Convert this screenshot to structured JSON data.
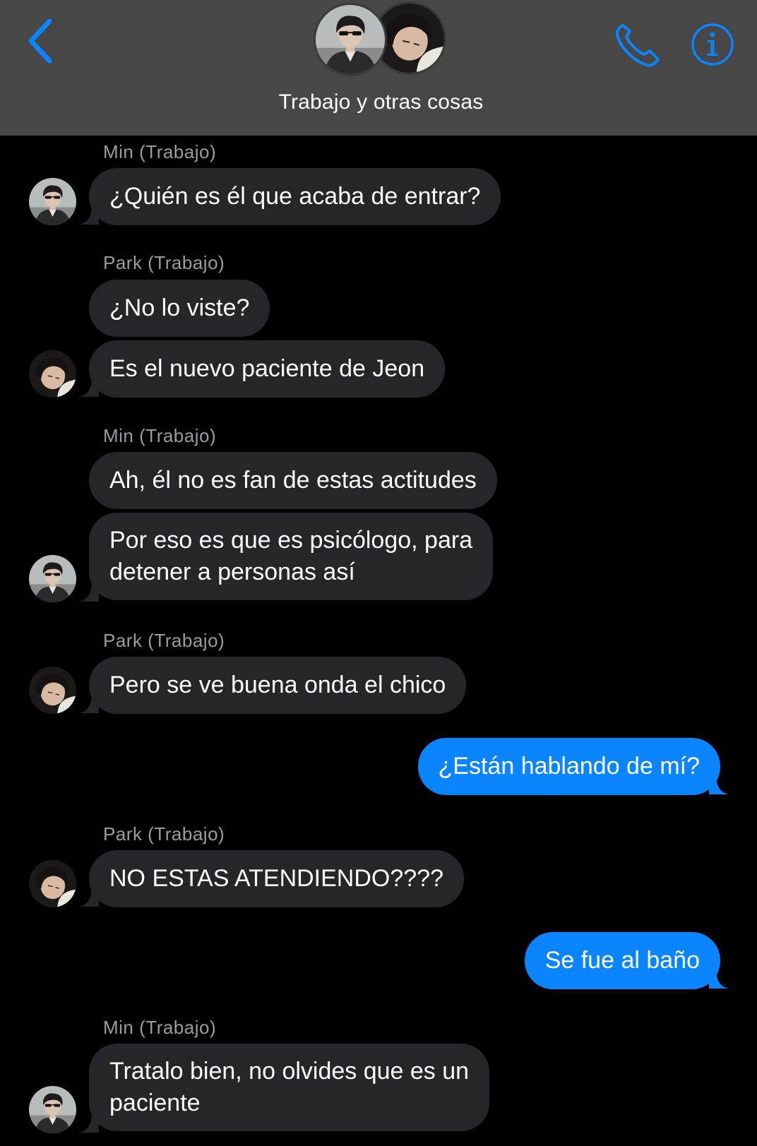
{
  "header": {
    "title": "Trabajo y otras cosas",
    "accent_color": "#0a84ff",
    "icons": [
      "chevron-left-icon",
      "phone-icon",
      "info-icon"
    ]
  },
  "messages": [
    {
      "sender": "Min (Trabajo)",
      "text": "¿Quién es él que acaba de entrar?"
    },
    {
      "sender": "Park (Trabajo)",
      "text": "¿No lo viste?"
    },
    {
      "text": "Es el nuevo paciente de Jeon"
    },
    {
      "sender": "Min (Trabajo)",
      "text": "Ah, él no es fan de estas actitudes"
    },
    {
      "lines": [
        "Por eso es que es psicólogo, para",
        "detener a personas así"
      ]
    },
    {
      "sender": "Park (Trabajo)",
      "text": "Pero se ve buena onda el chico"
    },
    {
      "text": "¿Están hablando de mí?",
      "outgoing": true
    },
    {
      "sender": "Park (Trabajo)",
      "text": "NO ESTAS ATENDIENDO????"
    },
    {
      "text": "Se fue al baño",
      "outgoing": true
    },
    {
      "sender": "Min (Trabajo)",
      "lines": [
        "Tratalo bien, no olvides que es un",
        "paciente"
      ]
    }
  ],
  "colors": {
    "incoming_bubble": "#26252a",
    "outgoing_bubble": "#0a84ff",
    "header_background": "#474747",
    "sender_label": "#9b9ba1"
  }
}
